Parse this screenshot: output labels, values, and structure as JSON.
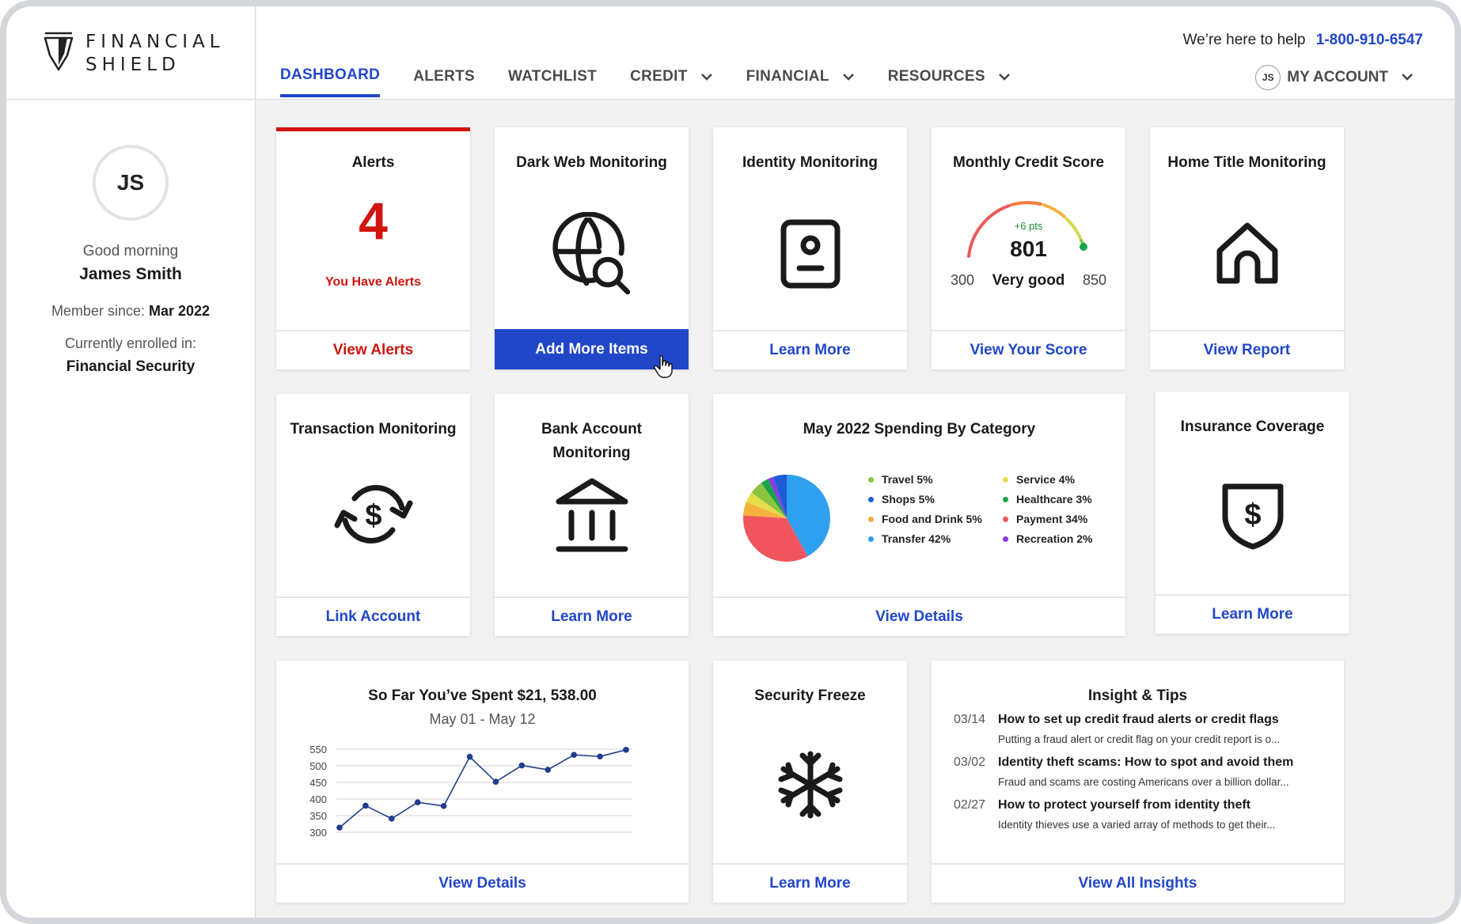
{
  "brand": {
    "name_line1": "FINANCIAL",
    "name_line2": "SHIELD"
  },
  "header": {
    "help_text": "We’re here to help",
    "phone": "1-800-910-6547",
    "account_initials": "JS",
    "account_label": "MY ACCOUNT"
  },
  "nav": {
    "items": [
      {
        "label": "DASHBOARD",
        "active": true
      },
      {
        "label": "ALERTS"
      },
      {
        "label": "WATCHLIST"
      },
      {
        "label": "CREDIT",
        "dropdown": true
      },
      {
        "label": "FINANCIAL",
        "dropdown": true
      },
      {
        "label": "RESOURCES",
        "dropdown": true
      }
    ]
  },
  "sidebar": {
    "initials": "JS",
    "greeting": "Good morning",
    "name": "James Smith",
    "member_label": "Member since: ",
    "member_since": "Mar 2022",
    "enrolled_label": "Currently enrolled in:",
    "plan": "Financial Security"
  },
  "cards": {
    "alerts": {
      "title": "Alerts",
      "count": "4",
      "subtitle": "You Have Alerts",
      "action": "View Alerts"
    },
    "dark_web": {
      "title": "Dark Web Monitoring",
      "action": "Add More Items"
    },
    "identity": {
      "title": "Identity Monitoring",
      "action": "Learn More"
    },
    "credit": {
      "title": "Monthly Credit Score",
      "delta": "+6 pts",
      "score": "801",
      "rating": "Very good",
      "min": "300",
      "max": "850",
      "action": "View Your Score"
    },
    "home_title": {
      "title": "Home Title Monitoring",
      "action": "View Report"
    },
    "transaction": {
      "title": "Transaction Monitoring",
      "action": "Link Account"
    },
    "bank": {
      "title_line1": "Bank Account",
      "title_line2": "Monitoring",
      "action": "Learn More"
    },
    "spending": {
      "title": "May 2022 Spending By Category",
      "action": "View Details",
      "legend": [
        {
          "label": "Travel 5%",
          "color": "#8bc53f"
        },
        {
          "label": "Service 4%",
          "color": "#e6dc4a"
        },
        {
          "label": "Shops 5%",
          "color": "#1f5bd8"
        },
        {
          "label": "Healthcare 3%",
          "color": "#1aa34a"
        },
        {
          "label": "Food and Drink 5%",
          "color": "#f5b13c"
        },
        {
          "label": "Payment 34%",
          "color": "#f0555e"
        },
        {
          "label": "Transfer 42%",
          "color": "#2f9ff0"
        },
        {
          "label": "Recreation 2%",
          "color": "#8b3be0"
        }
      ]
    },
    "insurance": {
      "title": "Insurance Coverage",
      "action": "Learn More"
    },
    "spent": {
      "title": "So Far You’ve Spent $21, 538.00",
      "range": "May 01 - May 12",
      "action": "View Details"
    },
    "freeze": {
      "title": "Security Freeze",
      "action": "Learn More"
    },
    "insights": {
      "title": "Insight & Tips",
      "action": "View All Insights",
      "items": [
        {
          "date": "03/14",
          "title": "How to set up credit fraud alerts or credit flags",
          "desc": "Putting a fraud alert or credit flag on your credit report is o..."
        },
        {
          "date": "03/02",
          "title": "Identity theft scams: How to spot and avoid them",
          "desc": "Fraud and scams are costing Americans over a billion dollar..."
        },
        {
          "date": "02/27",
          "title": "How to protect yourself from identity theft",
          "desc": "Identity thieves use a varied array of methods to get their..."
        }
      ]
    }
  },
  "chart_data": [
    {
      "type": "pie",
      "title": "May 2022 Spending By Category",
      "categories": [
        "Transfer",
        "Payment",
        "Food and Drink",
        "Service",
        "Travel",
        "Healthcare",
        "Recreation",
        "Shops"
      ],
      "values": [
        42,
        34,
        5,
        4,
        5,
        3,
        2,
        5
      ],
      "colors": [
        "#2f9ff0",
        "#f0555e",
        "#f5b13c",
        "#e6dc4a",
        "#8bc53f",
        "#1aa34a",
        "#8b3be0",
        "#1f5bd8"
      ]
    },
    {
      "type": "line",
      "title": "So Far You’ve Spent $21, 538.00",
      "subtitle": "May 01 - May 12",
      "y": [
        314,
        380,
        341,
        390,
        379,
        527,
        452,
        501,
        488,
        533,
        528,
        548
      ],
      "ylim": [
        300,
        550
      ],
      "yticks": [
        300,
        350,
        400,
        450,
        500,
        550
      ],
      "grid": true,
      "color": "#1f3d8a"
    }
  ]
}
